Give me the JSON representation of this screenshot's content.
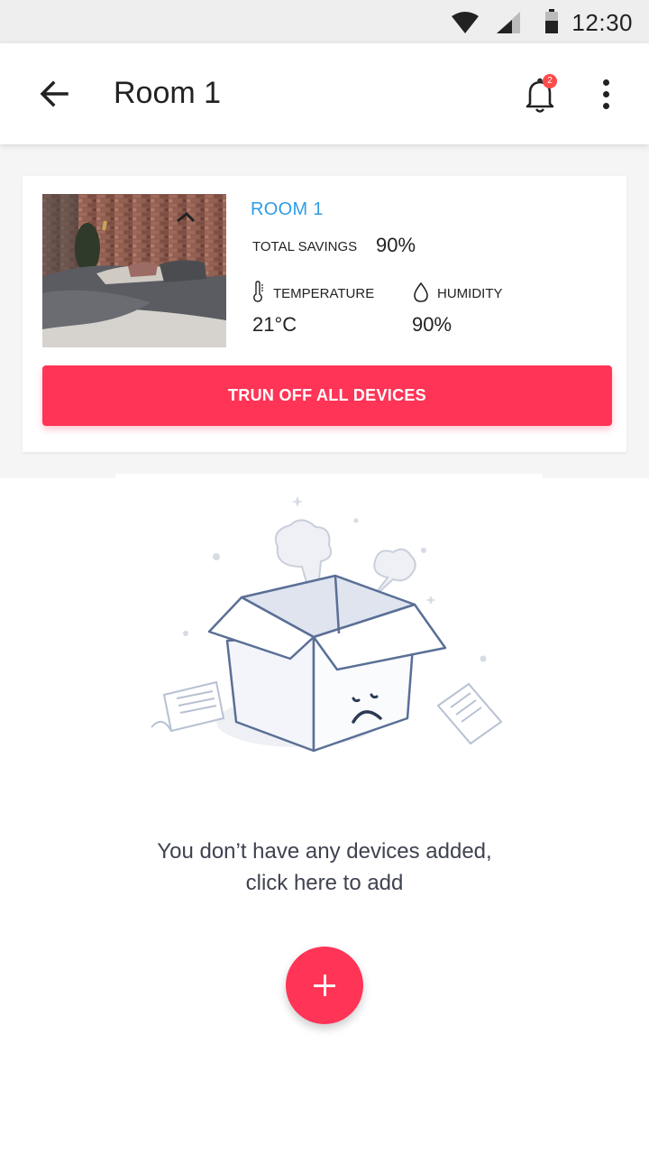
{
  "status_bar": {
    "time": "12:30",
    "icons": [
      "wifi-icon",
      "signal-icon",
      "battery-icon"
    ]
  },
  "app_bar": {
    "title": "Room 1",
    "notification_count": "2",
    "icons": [
      "back-arrow-icon",
      "bell-icon",
      "more-vert-icon"
    ]
  },
  "room_card": {
    "name": "ROOM 1",
    "total_savings_label": "TOTAL SAVINGS",
    "total_savings_value": "90%",
    "temperature_label": "TEMPERATURE",
    "temperature_value": "21°C",
    "humidity_label": "HUMIDITY",
    "humidity_value": "90%",
    "turn_off_label": "TRUN OFF ALL DEVICES"
  },
  "empty_state": {
    "message_line1": "You don’t have any devices added,",
    "message_line2": "click here to add"
  },
  "colors": {
    "accent": "#ff3456",
    "room_name": "#2f9de4",
    "illustration_stroke": "#5a6f96"
  }
}
